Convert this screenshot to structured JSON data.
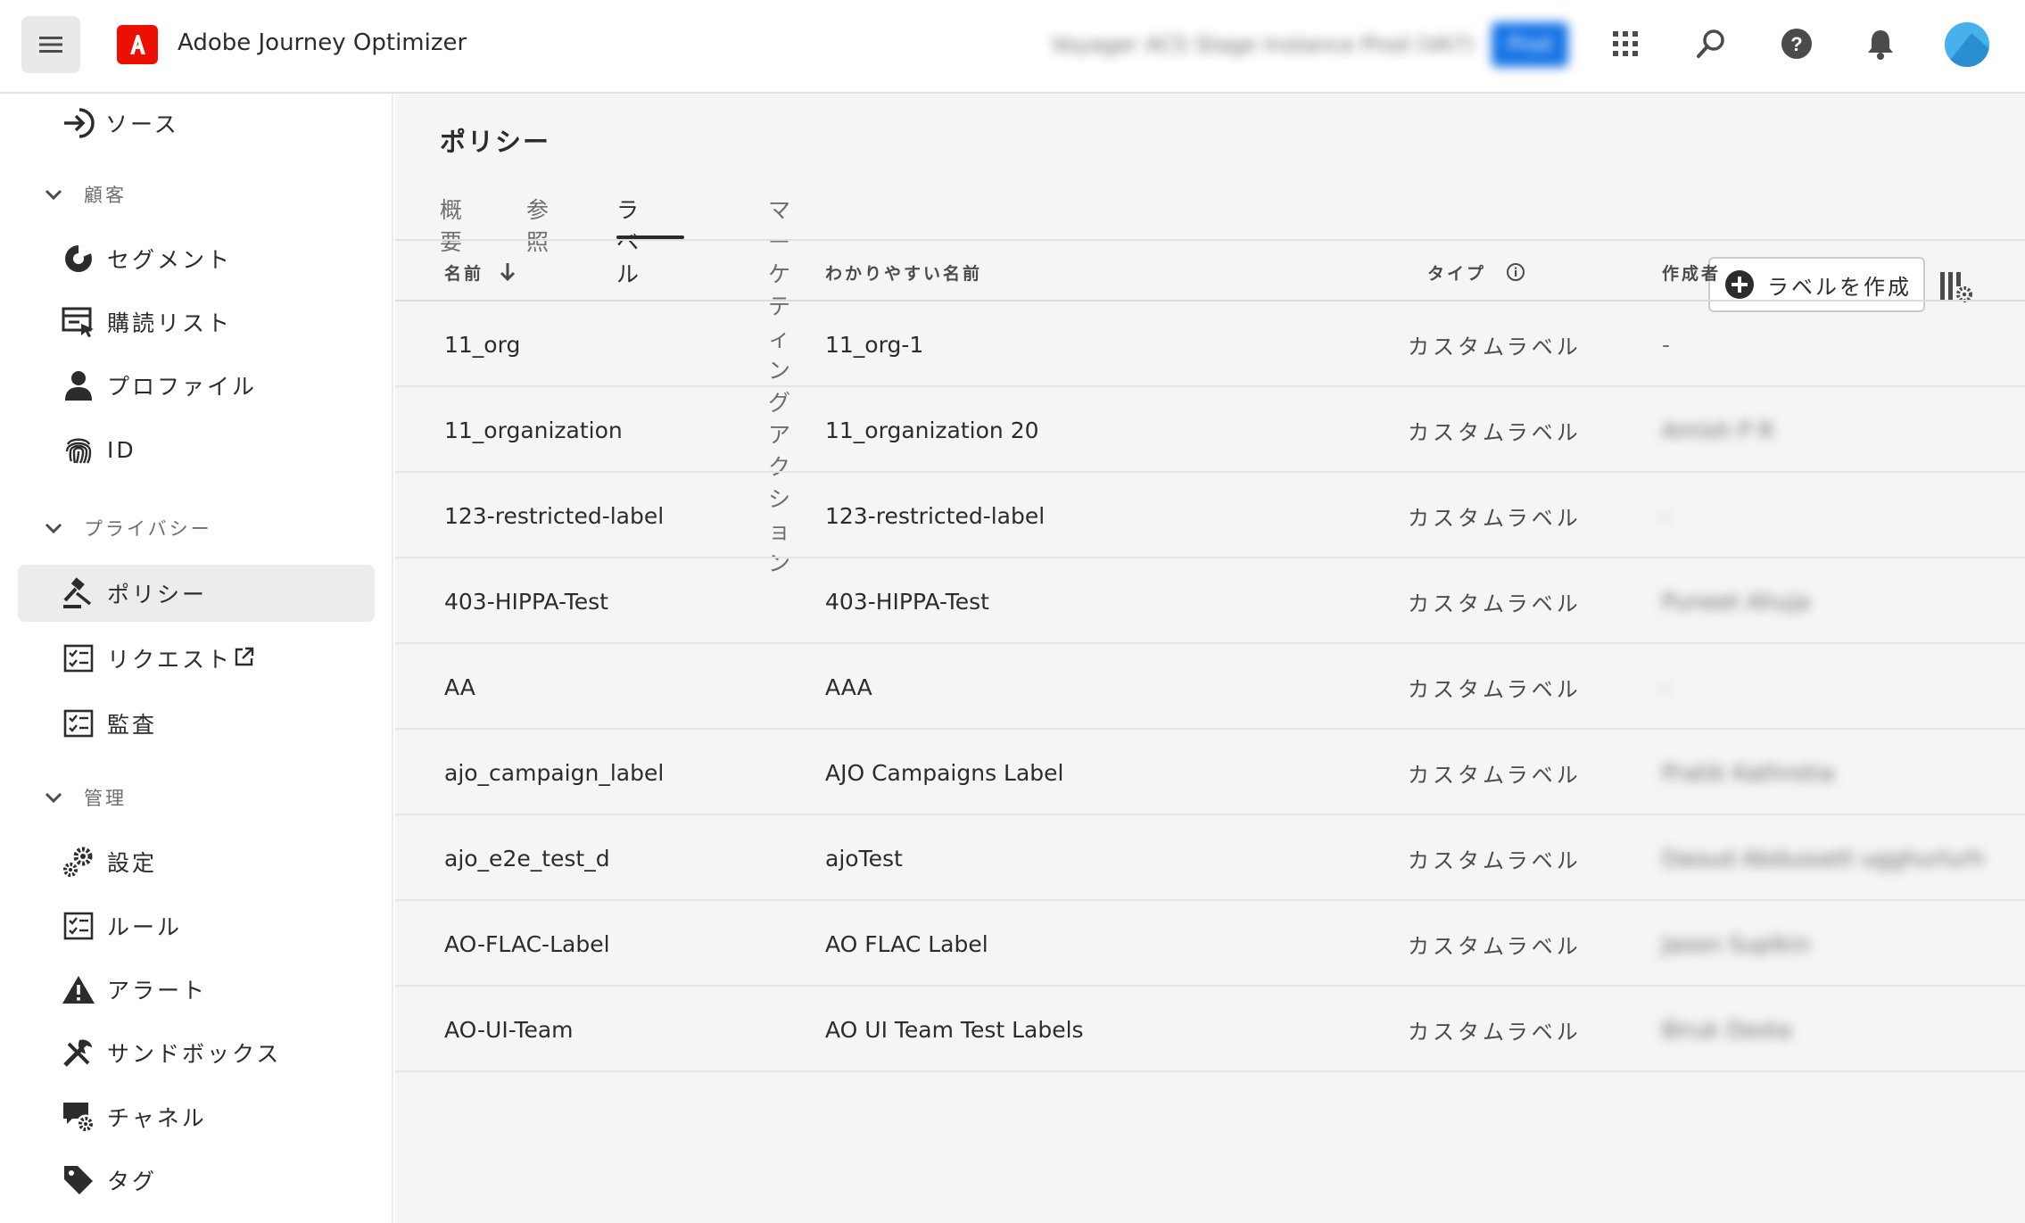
{
  "header": {
    "app_title": "Adobe Journey Optimizer",
    "sandbox_name": "Voyager ACS Stage Instance",
    "environment": "Prod (VA7)",
    "environment_badge": "Prod"
  },
  "sidebar": {
    "top_item": {
      "label": "ソース",
      "icon": "source-arrow-icon"
    },
    "sections": [
      {
        "label": "顧客",
        "items": [
          {
            "label": "セグメント",
            "icon": "segment-icon"
          },
          {
            "label": "購読リスト",
            "icon": "subscription-list-icon"
          },
          {
            "label": "プロファイル",
            "icon": "user-icon"
          },
          {
            "label": "ID",
            "icon": "fingerprint-icon"
          }
        ]
      },
      {
        "label": "プライバシー",
        "items": [
          {
            "label": "ポリシー",
            "icon": "gavel-icon",
            "active": true
          },
          {
            "label": "リクエスト",
            "icon": "checklist-icon",
            "external": true
          },
          {
            "label": "監査",
            "icon": "checklist-icon"
          }
        ]
      },
      {
        "label": "管理",
        "items": [
          {
            "label": "設定",
            "icon": "gears-icon"
          },
          {
            "label": "ルール",
            "icon": "checklist-icon"
          },
          {
            "label": "アラート",
            "icon": "alert-icon"
          },
          {
            "label": "サンドボックス",
            "icon": "tools-icon"
          },
          {
            "label": "チャネル",
            "icon": "channel-settings-icon"
          },
          {
            "label": "タグ",
            "icon": "tag-icon"
          }
        ]
      }
    ]
  },
  "main": {
    "title": "ポリシー",
    "tabs": [
      {
        "label": "概要",
        "active": false
      },
      {
        "label": "参照",
        "active": false
      },
      {
        "label": "ラベル",
        "active": true
      },
      {
        "label": "マーケティングアクション",
        "active": false
      }
    ],
    "create_button_label": "ラベルを作成",
    "table": {
      "columns": [
        "名前",
        "わかりやすい名前",
        "タイプ",
        "作成者"
      ],
      "sort": {
        "column": "名前",
        "direction": "descending"
      },
      "rows": [
        {
          "name": "11_org",
          "friendly_name": "11_org-1",
          "type": "カスタムラベル",
          "creator": "-",
          "creator_blurred": false
        },
        {
          "name": "11_organization",
          "friendly_name": "11_organization 20",
          "type": "カスタムラベル",
          "creator": "Amish P R",
          "creator_blurred": true
        },
        {
          "name": "123-restricted-label",
          "friendly_name": "123-restricted-label",
          "type": "カスタムラベル",
          "creator": "-",
          "creator_blurred": true
        },
        {
          "name": "403-HIPPA-Test",
          "friendly_name": "403-HIPPA-Test",
          "type": "カスタムラベル",
          "creator": "Puneet Ahuja",
          "creator_blurred": true
        },
        {
          "name": "AA",
          "friendly_name": "AAA",
          "type": "カスタムラベル",
          "creator": "-",
          "creator_blurred": true
        },
        {
          "name": "ajo_campaign_label",
          "friendly_name": "AJO Campaigns Label",
          "type": "カスタムラベル",
          "creator": "Pratik Kathrotia",
          "creator_blurred": true
        },
        {
          "name": "ajo_e2e_test_d",
          "friendly_name": "ajoTest",
          "type": "カスタムラベル",
          "creator": "Daoud Abdussett ugghurlurh",
          "creator_blurred": true
        },
        {
          "name": "AO-FLAC-Label",
          "friendly_name": "AO FLAC Label",
          "type": "カスタムラベル",
          "creator": "Jason Suplkin",
          "creator_blurred": true
        },
        {
          "name": "AO-UI-Team",
          "friendly_name": "AO UI Team Test Labels",
          "type": "カスタムラベル",
          "creator": "Biruk Desta",
          "creator_blurred": true
        }
      ]
    }
  }
}
